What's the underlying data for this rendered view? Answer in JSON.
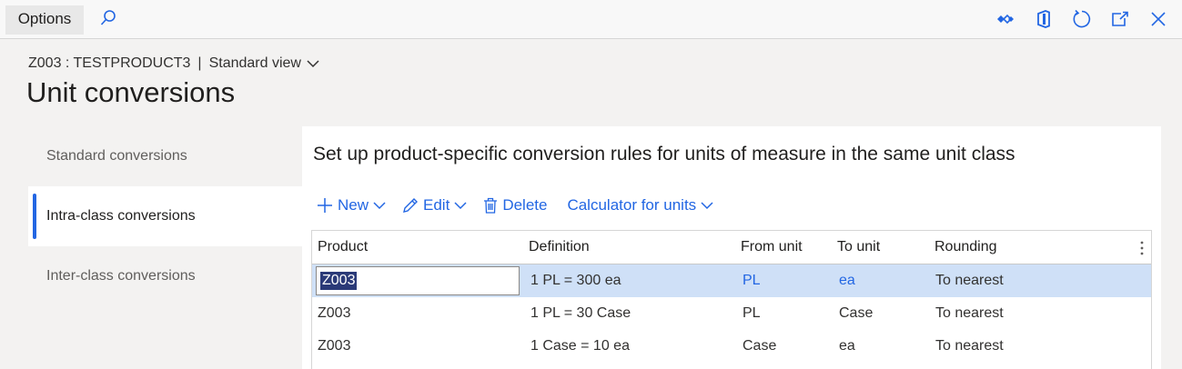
{
  "topbar": {
    "options_label": "Options",
    "icons": [
      "search-icon",
      "diamond-icon",
      "office-icon",
      "refresh-icon",
      "open-new-window-icon",
      "close-icon"
    ]
  },
  "header": {
    "record": "Z003 : TESTPRODUCT3",
    "separator": "|",
    "view": "Standard view",
    "title": "Unit conversions"
  },
  "nav": {
    "items": [
      {
        "label": "Standard conversions",
        "active": false
      },
      {
        "label": "Intra-class conversions",
        "active": true
      },
      {
        "label": "Inter-class conversions",
        "active": false
      }
    ]
  },
  "panel": {
    "title": "Set up product-specific conversion rules for units of measure in the same unit class"
  },
  "toolbar": {
    "new_label": "New",
    "edit_label": "Edit",
    "delete_label": "Delete",
    "calculator_label": "Calculator for units"
  },
  "grid": {
    "columns": [
      "Product",
      "Definition",
      "From unit",
      "To unit",
      "Rounding"
    ],
    "rows": [
      {
        "product": "Z003",
        "definition": "1 PL = 300 ea",
        "from_unit": "PL",
        "to_unit": "ea",
        "rounding": "To nearest",
        "selected": true
      },
      {
        "product": "Z003",
        "definition": "1 PL = 30 Case",
        "from_unit": "PL",
        "to_unit": "Case",
        "rounding": "To nearest",
        "selected": false
      },
      {
        "product": "Z003",
        "definition": "1 Case = 10 ea",
        "from_unit": "Case",
        "to_unit": "ea",
        "rounding": "To nearest",
        "selected": false
      }
    ]
  },
  "colors": {
    "accent": "#2266e3",
    "selected_row": "#cfe0f7"
  }
}
